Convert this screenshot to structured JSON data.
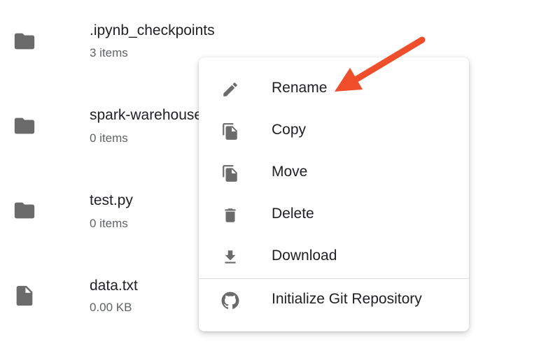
{
  "files": [
    {
      "name": ".ipynb_checkpoints",
      "meta": "3 items",
      "icon": "folder-icon"
    },
    {
      "name": "spark-warehouse",
      "meta": "0 items",
      "icon": "folder-icon"
    },
    {
      "name": "test.py",
      "meta": "0 items",
      "icon": "folder-icon"
    },
    {
      "name": "data.txt",
      "meta": "0.00 KB",
      "icon": "file-icon"
    }
  ],
  "context_menu": {
    "items": [
      {
        "label": "Rename",
        "icon": "pencil-icon"
      },
      {
        "label": "Copy",
        "icon": "copy-icon"
      },
      {
        "label": "Move",
        "icon": "move-icon"
      },
      {
        "label": "Delete",
        "icon": "trash-icon"
      },
      {
        "label": "Download",
        "icon": "download-icon"
      },
      {
        "label": "Initialize Git Repository",
        "icon": "github-icon"
      }
    ]
  },
  "colors": {
    "icon_gray": "#6b6b6b",
    "arrow": "#f04e2b",
    "text": "#202124",
    "meta_text": "#5f6368"
  }
}
